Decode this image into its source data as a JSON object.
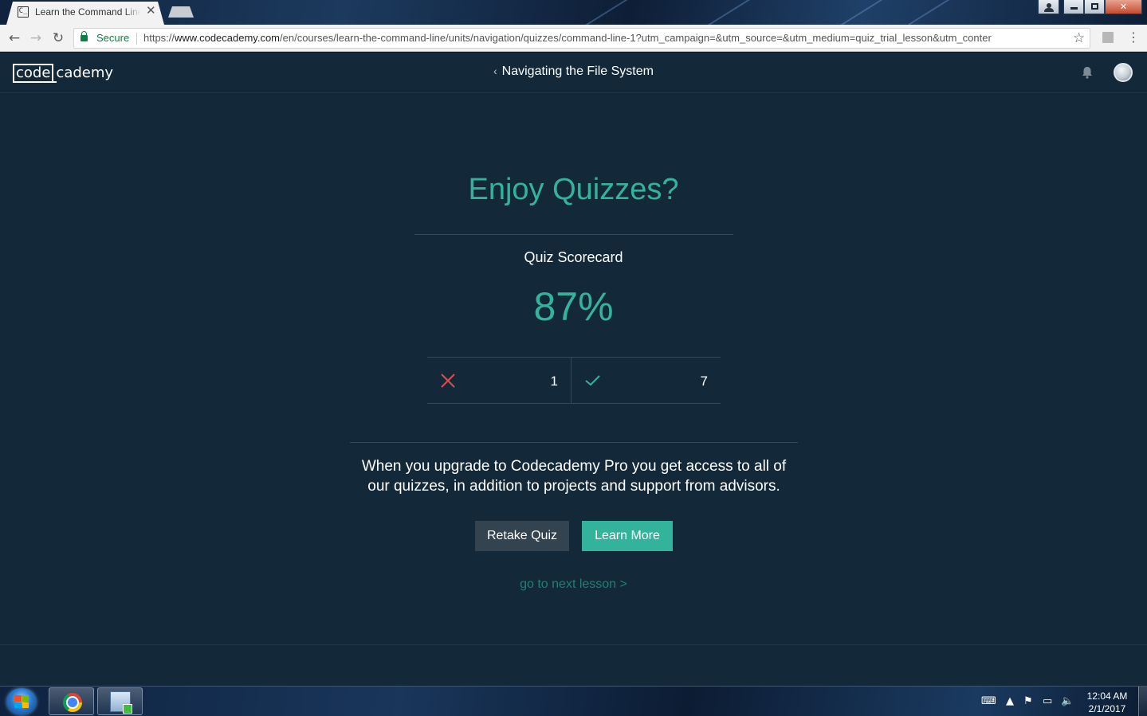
{
  "browser": {
    "tab_title": "Learn the Command Line",
    "tab_favicon": "C_",
    "secure_label": "Secure",
    "url_scheme": "https://",
    "url_host": "www.codecademy.com",
    "url_path": "/en/courses/learn-the-command-line/units/navigation/quizzes/command-line-1?utm_campaign=&utm_source=&utm_medium=quiz_trial_lesson&utm_conter"
  },
  "site": {
    "logo_code": "code",
    "logo_rest": "cademy",
    "breadcrumb_title": "Navigating the File System"
  },
  "quiz": {
    "heading": "Enjoy Quizzes?",
    "scorecard_label": "Quiz Scorecard",
    "score_percent": "87%",
    "wrong_count": "1",
    "right_count": "7",
    "upsell_text": "When you upgrade to Codecademy Pro you get access to all of our quizzes, in addition to projects and support from advisors.",
    "retake_label": "Retake Quiz",
    "learn_more_label": "Learn More",
    "next_lesson_label": "go to next lesson >"
  },
  "taskbar": {
    "time": "12:04 AM",
    "date": "2/1/2017"
  },
  "colors": {
    "accent": "#33b39c",
    "panel_bg": "#13293a",
    "wrong": "#e04b4b",
    "right": "#33b39c"
  },
  "icons": {
    "wrong": "x-mark-icon",
    "right": "check-mark-icon"
  }
}
